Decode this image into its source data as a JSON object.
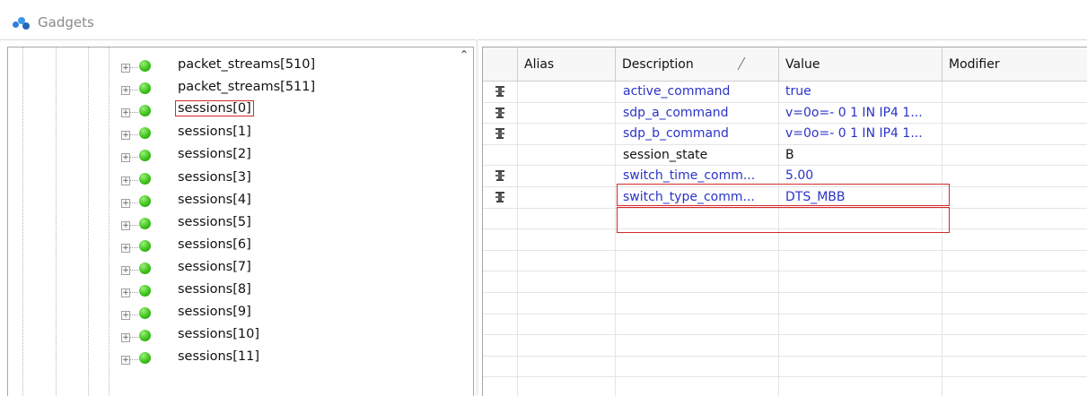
{
  "window": {
    "title": "Gadgets",
    "icon": "gadgets-icon"
  },
  "tree": {
    "items": [
      {
        "label": "packet_streams[510]",
        "selected": false
      },
      {
        "label": "packet_streams[511]",
        "selected": false
      },
      {
        "label": "sessions[0]",
        "selected": true
      },
      {
        "label": "sessions[1]",
        "selected": false
      },
      {
        "label": "sessions[2]",
        "selected": false
      },
      {
        "label": "sessions[3]",
        "selected": false
      },
      {
        "label": "sessions[4]",
        "selected": false
      },
      {
        "label": "sessions[5]",
        "selected": false
      },
      {
        "label": "sessions[6]",
        "selected": false
      },
      {
        "label": "sessions[7]",
        "selected": false
      },
      {
        "label": "sessions[8]",
        "selected": false
      },
      {
        "label": "sessions[9]",
        "selected": false
      },
      {
        "label": "sessions[10]",
        "selected": false
      },
      {
        "label": "sessions[11]",
        "selected": false
      }
    ],
    "status_color": "#3ec31c"
  },
  "grid": {
    "columns": [
      "Alias",
      "Description",
      "Value",
      "Modifier"
    ],
    "sort_column": "Description",
    "rows": [
      {
        "command": true,
        "description": "active_command",
        "value": "true",
        "blue": true
      },
      {
        "command": true,
        "description": "sdp_a_command",
        "value": "v=0o=- 0 1 IN IP4 1...",
        "blue": true
      },
      {
        "command": true,
        "description": "sdp_b_command",
        "value": "v=0o=- 0 1 IN IP4 1...",
        "blue": true
      },
      {
        "command": false,
        "description": "session_state",
        "value": "B",
        "blue": false
      },
      {
        "command": true,
        "description": "switch_time_comm...",
        "value": "5.00",
        "blue": true
      },
      {
        "command": true,
        "description": "switch_type_comm...",
        "value": "DTS_MBB",
        "blue": true
      }
    ],
    "highlight_color": "#d42a2a",
    "link_color": "#2b33c6"
  }
}
